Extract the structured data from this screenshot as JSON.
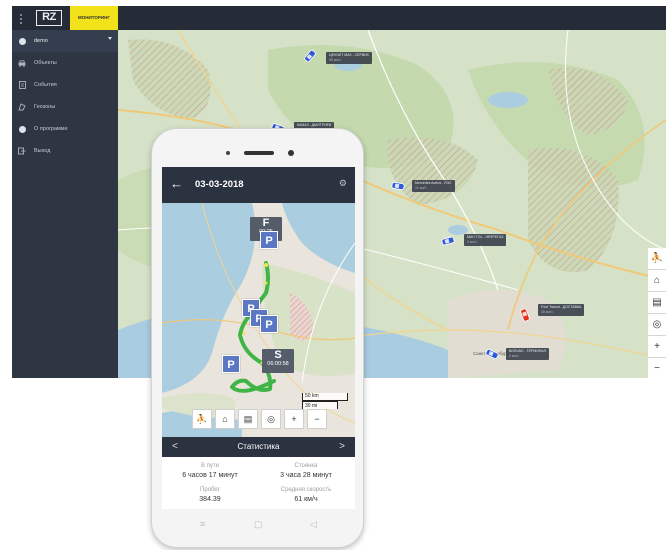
{
  "app": {
    "logo": "RZ",
    "mode_badge": "мониторинг",
    "user_label": "demo",
    "menu": [
      {
        "label": "Объекты",
        "icon": "car-icon"
      },
      {
        "label": "События",
        "icon": "document-icon"
      },
      {
        "label": "Геозоны",
        "icon": "geofence-icon"
      },
      {
        "label": "О программе",
        "icon": "info-icon"
      },
      {
        "label": "Выход",
        "icon": "logout-icon"
      }
    ]
  },
  "map": {
    "vehicles": [
      {
        "title": "ЦЕНЗИТ МАЗ - СЕРВИС",
        "status": "55 км/ч",
        "color": "#2f59d6"
      },
      {
        "title": "КАМАЗ - ДМИТРИЕВ",
        "status": "0 км/ч",
        "color": "#2f59d6"
      },
      {
        "title": "Mercedes Actros - ЛЭС",
        "status": "11 км/ч",
        "color": "#2f59d6"
      },
      {
        "title": "МАН TGL - НЕФТЕГАЗ",
        "status": "0 км/ч",
        "color": "#2f59d6"
      },
      {
        "title": "Ford Transit - ДОСТАВКА",
        "status": "45 км/ч",
        "color": "#e0311a"
      },
      {
        "title": "ВОЛЬВО - ТЕРМИНАЛ",
        "status": "0 км/ч",
        "color": "#2f59d6"
      }
    ],
    "city_label": "Санкт-Петербург",
    "controls": [
      "runner-icon",
      "tag-icon",
      "map-icon",
      "locate-icon",
      "zoom-in-icon",
      "zoom-out-icon"
    ],
    "control_glyphs": [
      "⛹",
      "⌂",
      "▤",
      "◎",
      "+",
      "−"
    ]
  },
  "phone": {
    "date": "03-03-2018",
    "finish_marker": {
      "letter": "F",
      "time": "09:25"
    },
    "start_marker": {
      "letter": "S",
      "time": "06:00:58"
    },
    "parking_letter": "P",
    "scale": {
      "km": "50 km",
      "mi": "30 mi"
    },
    "controls": [
      "runner-icon",
      "tag-icon",
      "map-icon",
      "locate-icon",
      "zoom-in-icon",
      "zoom-out-icon"
    ],
    "control_glyphs": [
      "⛹",
      "⌂",
      "▤",
      "◎",
      "+",
      "−"
    ],
    "stats": {
      "title": "Статистика",
      "prev": "<",
      "next": ">",
      "items": [
        {
          "label": "В пути",
          "value": "6 часов 17 минут"
        },
        {
          "label": "Стоянка",
          "value": "3 часа 28 минут"
        },
        {
          "label": "Пробег",
          "value": "384.39"
        },
        {
          "label": "Средняя скорость",
          "value": "61 км/ч"
        }
      ]
    },
    "nav_keys": [
      "≡",
      "▢",
      "◁"
    ]
  },
  "colors": {
    "track": "#41b447",
    "pin": "#5b76c2",
    "header": "#2b3240",
    "accent": "#f2e21a"
  }
}
